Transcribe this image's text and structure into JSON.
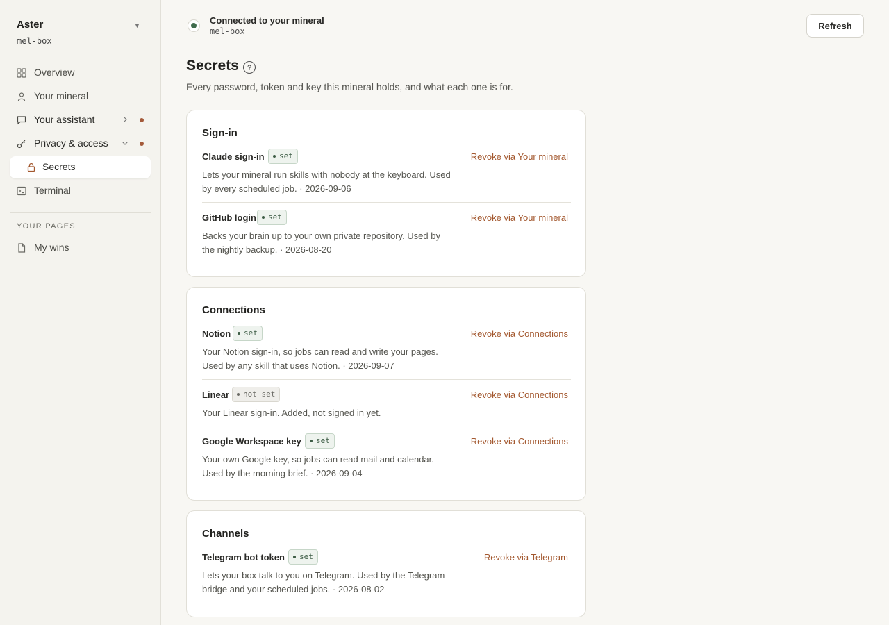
{
  "workspace": {
    "name": "Aster",
    "box": "mel-box"
  },
  "nav": {
    "overview": "Overview",
    "your_mineral": "Your mineral",
    "your_assistant": "Your assistant",
    "privacy_access": "Privacy & access",
    "secrets": "Secrets",
    "terminal": "Terminal",
    "section_label": "YOUR PAGES",
    "my_wins": "My wins"
  },
  "connection": {
    "title": "Connected to your mineral",
    "box": "mel-box"
  },
  "refresh_label": "Refresh",
  "page": {
    "title": "Secrets",
    "description": "Every password, token and key this mineral holds, and what each one is for."
  },
  "cards": [
    {
      "title": "Sign-in",
      "rows": [
        {
          "name": "Claude sign-in",
          "status": "set",
          "desc": "Lets your mineral run skills with nobody at the keyboard. Used by every scheduled job. · 2026-09-06",
          "revoke": "Revoke via Your mineral"
        },
        {
          "name": "GitHub login",
          "status": "set",
          "desc": "Backs your brain up to your own private repository. Used by the nightly backup. · 2026-08-20",
          "revoke": "Revoke via Your mineral"
        }
      ]
    },
    {
      "title": "Connections",
      "rows": [
        {
          "name": "Notion",
          "status": "set",
          "desc": "Your Notion sign-in, so jobs can read and write your pages. Used by any skill that uses Notion. · 2026-09-07",
          "revoke": "Revoke via Connections"
        },
        {
          "name": "Linear",
          "status": "not set",
          "desc": "Your Linear sign-in. Added, not signed in yet.",
          "revoke": "Revoke via Connections"
        },
        {
          "name": "Google Workspace key",
          "status": "set",
          "desc": "Your own Google key, so jobs can read mail and calendar. Used by the morning brief. · 2026-09-04",
          "revoke": "Revoke via Connections"
        }
      ]
    },
    {
      "title": "Channels",
      "rows": [
        {
          "name": "Telegram bot token",
          "status": "set",
          "desc": "Lets your box talk to you on Telegram. Used by the Telegram bridge and your scheduled jobs. · 2026-08-02",
          "revoke": "Revoke via Telegram"
        }
      ]
    }
  ],
  "colors": {
    "accent": "#a3582f",
    "set_green": "#3d5c45",
    "alert_dot": "#a45a3a"
  }
}
